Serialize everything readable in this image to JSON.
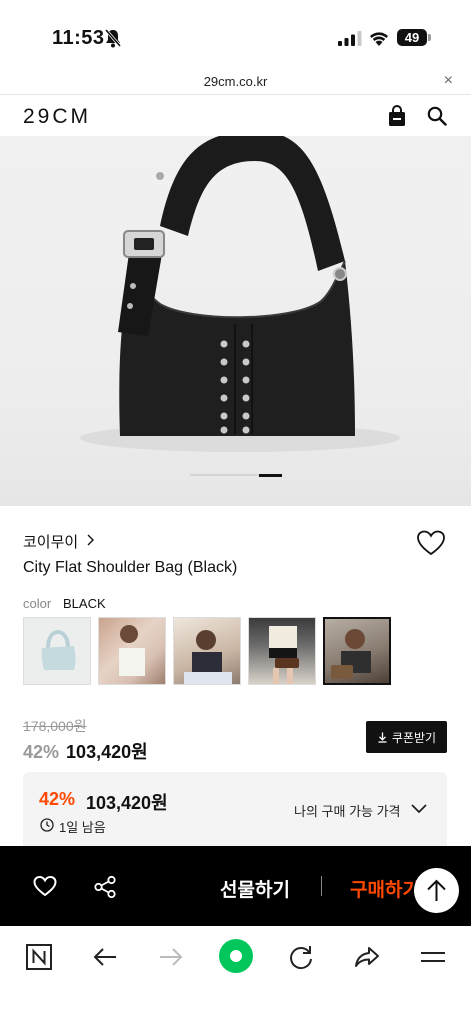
{
  "status_bar": {
    "time": "11:53",
    "battery": "49",
    "icons": [
      "bell-off-icon",
      "signal-icon",
      "wifi-icon",
      "battery-icon"
    ]
  },
  "browser": {
    "url": "29cm.co.kr",
    "close_symbol": "×"
  },
  "header": {
    "logo": "29CM",
    "icons": [
      "shopping-bag-icon",
      "search-icon"
    ]
  },
  "gallery": {
    "current_slide": 4,
    "total_slides": 4
  },
  "product": {
    "brand": "코이무이",
    "name": "City Flat Shoulder Bag (Black)",
    "color_label": "color",
    "color_value": "BLACK",
    "swatch_count": 5,
    "selected_swatch": 5,
    "original_price": "178,000원",
    "discount": "42%",
    "price": "103,420원",
    "coupon_label": "쿠폰받기"
  },
  "my_price": {
    "discount": "42%",
    "price": "103,420원",
    "remaining": "1일 남음",
    "label": "나의 구매 가능 가격"
  },
  "action_bar": {
    "gift_label": "선물하기",
    "buy_label": "구매하기"
  },
  "colors": {
    "accent": "#ff4800",
    "naver_green": "#03c75a",
    "bar_bg": "#000000"
  }
}
